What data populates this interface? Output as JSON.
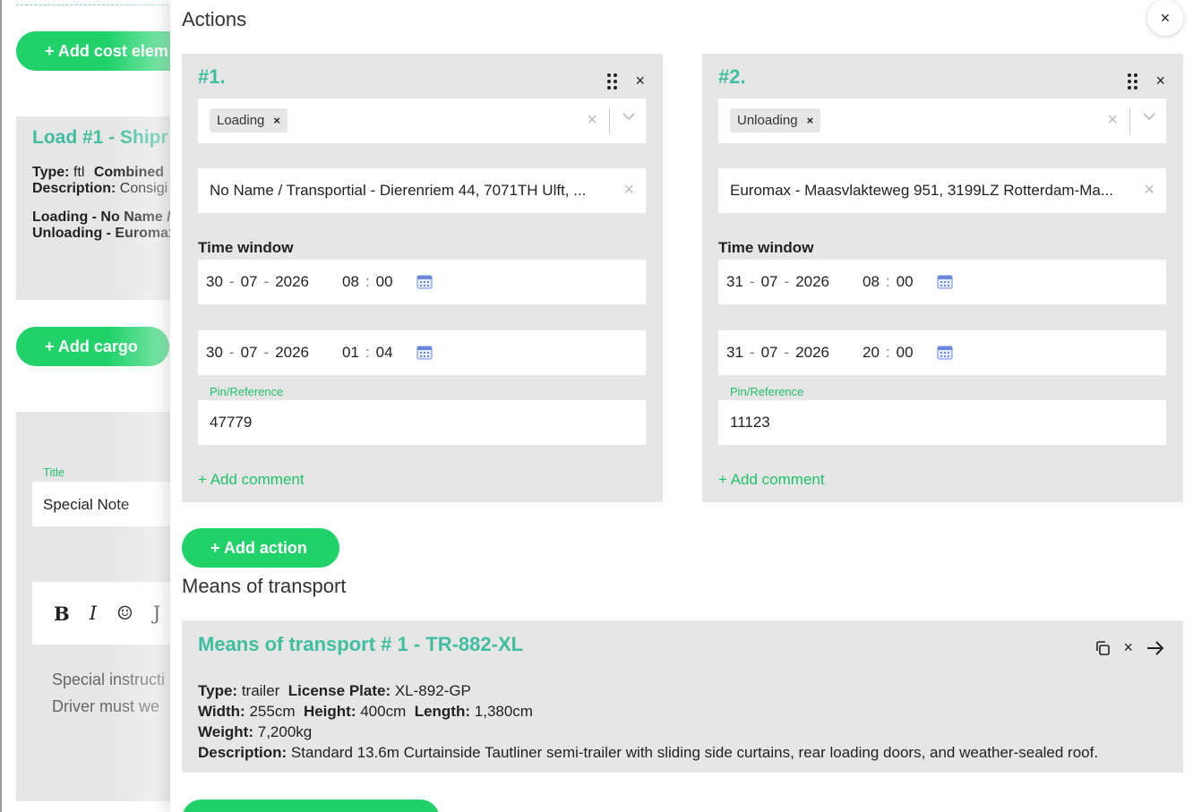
{
  "background": {
    "add_cost_label": "+ Add cost elem",
    "load_title": "Load #1 - Shipr",
    "load_type_key": "Type:",
    "load_type_val": "ftl",
    "load_combined": "Combined",
    "load_desc_key": "Description:",
    "load_desc_val": "Consigi",
    "loading_line": "Loading - No Name /",
    "unloading_line": "Unloading - Euromax",
    "add_cargo_label": "+ Add cargo",
    "note_title_label": "Title",
    "note_title_value": "Special Note",
    "toolbar": {
      "bold": "B",
      "italic": "I",
      "emoji": "☺",
      "more": "J"
    },
    "note_line_1": "Special instructi",
    "note_line_2": "Driver must we"
  },
  "drawer": {
    "actions_title": "Actions",
    "close_symbol": "×",
    "add_action_label": "+ Add action",
    "means_title": "Means of transport"
  },
  "actions": [
    {
      "number": "#1.",
      "type_tag": "Loading",
      "address": "No Name / Transportial - Dierenriem 44, 7071TH Ulft, ...",
      "time_window_label": "Time window",
      "from": {
        "dd": "30",
        "mm": "07",
        "yyyy": "2026",
        "hh": "08",
        "min": "00"
      },
      "to": {
        "dd": "30",
        "mm": "07",
        "yyyy": "2026",
        "hh": "01",
        "min": "04"
      },
      "pin_label": "Pin/Reference",
      "pin_value": "47779",
      "add_comment": "+ Add comment"
    },
    {
      "number": "#2.",
      "type_tag": "Unloading",
      "address": "Euromax - Maasvlakteweg 951, 3199LZ Rotterdam-Ma...",
      "time_window_label": "Time window",
      "from": {
        "dd": "31",
        "mm": "07",
        "yyyy": "2026",
        "hh": "08",
        "min": "00"
      },
      "to": {
        "dd": "31",
        "mm": "07",
        "yyyy": "2026",
        "hh": "20",
        "min": "00"
      },
      "pin_label": "Pin/Reference",
      "pin_value": "11123",
      "add_comment": "+ Add comment"
    }
  ],
  "transport": {
    "name": "Means of transport # 1 - TR-882-XL",
    "type_key": "Type:",
    "type_val": "trailer",
    "plate_key": "License Plate:",
    "plate_val": "XL-892-GP",
    "width_key": "Width:",
    "width_val": "255cm",
    "height_key": "Height:",
    "height_val": "400cm",
    "length_key": "Length:",
    "length_val": "1,380cm",
    "weight_key": "Weight:",
    "weight_val": "7,200kg",
    "desc_key": "Description:",
    "desc_val": "Standard 13.6m Curtainside Tautliner semi-trailer with sliding side curtains, rear loading doors, and weather-sealed roof."
  },
  "icons": {
    "close": "close-icon",
    "drag": "drag-handle-icon",
    "chevron": "chevron-down-icon",
    "calendar": "calendar-icon",
    "copy": "copy-icon",
    "arrow": "arrow-right-icon"
  },
  "colors": {
    "accent_green": "#21d26b",
    "title_teal": "#3fbf9f",
    "card_gray": "#e6e6e6"
  }
}
